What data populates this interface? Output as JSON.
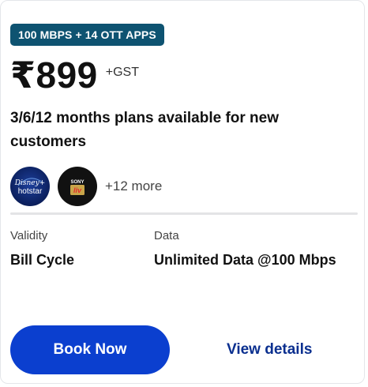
{
  "plan": {
    "badge": "100 MBPS + 14 OTT APPS",
    "price": "₹899",
    "tax_note": "+GST",
    "description": "3/6/12 months plans available for new customers"
  },
  "apps": {
    "logos": [
      {
        "name": "Disney+ hotstar",
        "icon": "disney-hotstar-logo",
        "line1": "Disney+",
        "line2": "hotstar"
      },
      {
        "name": "SonyLIV",
        "icon": "sonyliv-logo",
        "line1": "SONY",
        "line2": "liv"
      }
    ],
    "more_label": "+12 more"
  },
  "details": {
    "validity_label": "Validity",
    "validity_value": "Bill Cycle",
    "data_label": "Data",
    "data_value": "Unlimited Data @100 Mbps"
  },
  "actions": {
    "book_label": "Book Now",
    "view_label": "View details"
  },
  "colors": {
    "badge_bg": "#0e5371",
    "primary_button": "#0b3fcf",
    "link": "#0a2f8f"
  }
}
